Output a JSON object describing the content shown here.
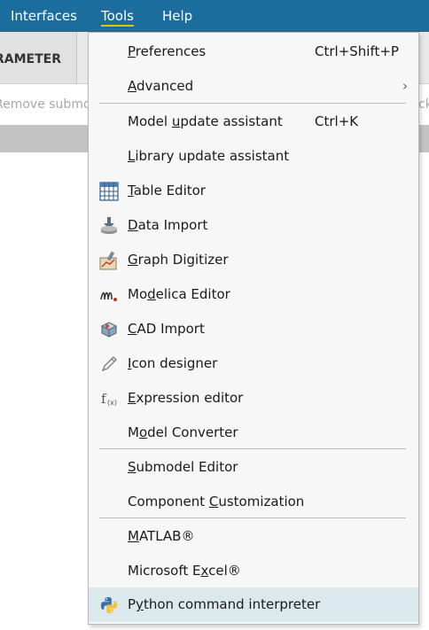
{
  "menubar": {
    "interfaces": "Interfaces",
    "tools": "Tools",
    "help": "Help"
  },
  "tabstrip": {
    "tab_label": "RAMETER"
  },
  "toolbar": {
    "left_text": "Remove submo",
    "right_text": "ck"
  },
  "tools_menu": {
    "items": [
      {
        "pre": "",
        "acc": "P",
        "post": "references",
        "shortcut": "Ctrl+Shift+P"
      },
      {
        "pre": "",
        "acc": "A",
        "post": "dvanced",
        "has_submenu": true
      },
      {
        "pre": "Model ",
        "acc": "u",
        "post": "pdate assistant",
        "shortcut": "Ctrl+K"
      },
      {
        "pre": "",
        "acc": "L",
        "post": "ibrary update assistant"
      },
      {
        "pre": "",
        "acc": "T",
        "post": "able Editor",
        "icon": "table-icon"
      },
      {
        "pre": "",
        "acc": "D",
        "post": "ata Import",
        "icon": "data-import-icon"
      },
      {
        "pre": "",
        "acc": "G",
        "post": "raph Digitizer",
        "icon": "graph-digitizer-icon"
      },
      {
        "pre": "Mo",
        "acc": "d",
        "post": "elica Editor",
        "icon": "modelica-icon"
      },
      {
        "pre": "",
        "acc": "C",
        "post": "AD Import",
        "icon": "cad-import-icon"
      },
      {
        "pre": "",
        "acc": "I",
        "post": "con designer",
        "icon": "pencil-icon"
      },
      {
        "pre": "",
        "acc": "E",
        "post": "xpression editor",
        "icon": "function-icon"
      },
      {
        "pre": "M",
        "acc": "o",
        "post": "del Converter"
      },
      {
        "pre": "",
        "acc": "S",
        "post": "ubmodel Editor"
      },
      {
        "pre": "Component ",
        "acc": "C",
        "post": "ustomization"
      },
      {
        "pre": "",
        "acc": "M",
        "post": "ATLAB®"
      },
      {
        "pre": "Microsoft E",
        "acc": "x",
        "post": "cel®"
      },
      {
        "pre": "P",
        "acc": "y",
        "post": "thon command interpreter",
        "icon": "python-icon"
      }
    ]
  }
}
